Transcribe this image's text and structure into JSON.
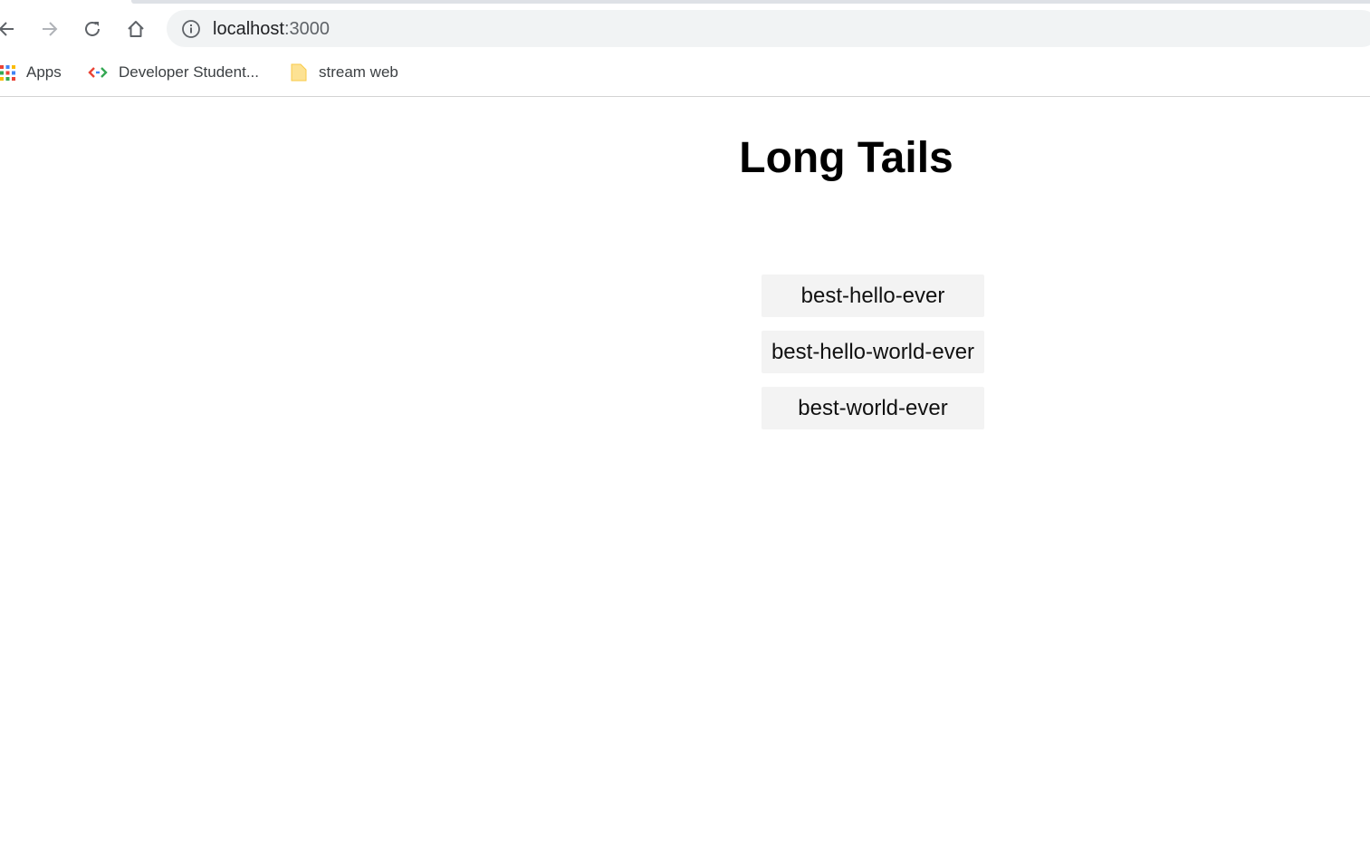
{
  "browser": {
    "url_host": "localhost",
    "url_port": ":3000",
    "bookmarks": [
      {
        "label": "Apps",
        "icon": "apps-grid-icon"
      },
      {
        "label": "Developer Student...",
        "icon": "dsc-brackets-icon"
      },
      {
        "label": "stream web",
        "icon": "folder-icon"
      }
    ]
  },
  "page": {
    "title": "Long Tails",
    "links": [
      {
        "label": "best-hello-ever"
      },
      {
        "label": "best-hello-world-ever"
      },
      {
        "label": "best-world-ever"
      }
    ]
  },
  "colors": {
    "button_bg": "#f3f3f3",
    "omnibox_bg": "#f1f3f4"
  }
}
